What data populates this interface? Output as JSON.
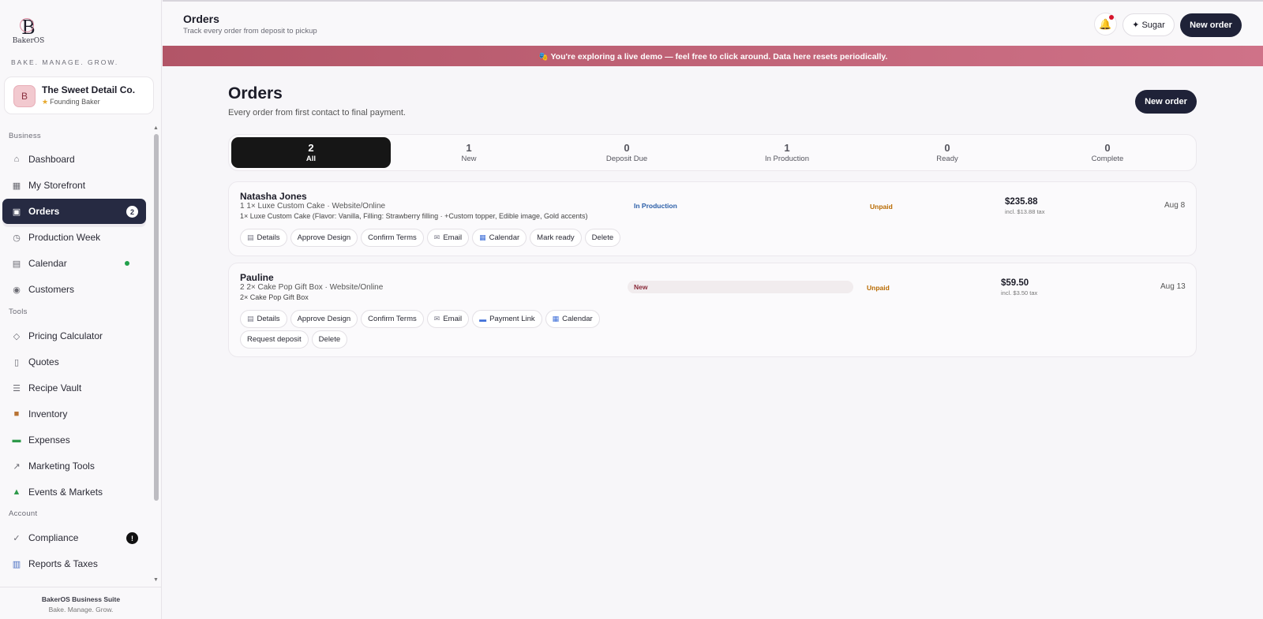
{
  "brand": {
    "mark": "B",
    "word": "BakerOS",
    "tagline": "BAKE. MANAGE. GROW."
  },
  "bakery": {
    "initial": "B",
    "name": "The Sweet Detail Co.",
    "badge": "Founding Baker"
  },
  "sidebar": {
    "sections": {
      "business": "Business",
      "tools": "Tools",
      "account": "Account"
    },
    "items": [
      {
        "label": "Dashboard",
        "icon": "home-icon"
      },
      {
        "label": "My Storefront",
        "icon": "picture-icon"
      },
      {
        "label": "Orders",
        "icon": "clipboard-icon",
        "badge": "2"
      },
      {
        "label": "Production Week",
        "icon": "clock-icon"
      },
      {
        "label": "Calendar",
        "icon": "calendar-icon"
      },
      {
        "label": "Customers",
        "icon": "user-icon"
      },
      {
        "label": "Pricing Calculator",
        "icon": "diamond-icon"
      },
      {
        "label": "Quotes",
        "icon": "document-icon"
      },
      {
        "label": "Recipe Vault",
        "icon": "list-icon"
      },
      {
        "label": "Inventory",
        "icon": "box-icon"
      },
      {
        "label": "Expenses",
        "icon": "money-icon"
      },
      {
        "label": "Marketing Tools",
        "icon": "trend-icon"
      },
      {
        "label": "Events & Markets",
        "icon": "tent-icon"
      },
      {
        "label": "Compliance",
        "icon": "check-icon",
        "alert": "!"
      },
      {
        "label": "Reports & Taxes",
        "icon": "bar-chart-icon"
      }
    ],
    "footer": {
      "title": "BakerOS Business Suite",
      "sub": "Bake. Manage. Grow."
    }
  },
  "topbar": {
    "title": "Orders",
    "subtitle": "Track every order from deposit to pickup",
    "sugar_label": "✦ Sugar",
    "new_order_label": "New order"
  },
  "banner": {
    "text": "🎭 You're exploring a live demo — feel free to click around. Data here resets periodically."
  },
  "main": {
    "title": "Orders",
    "subtitle": "Every order from first contact to final payment.",
    "new_order_label": "New order"
  },
  "tabs": [
    {
      "count": "2",
      "label": "All"
    },
    {
      "count": "1",
      "label": "New"
    },
    {
      "count": "0",
      "label": "Deposit Due"
    },
    {
      "count": "1",
      "label": "In Production"
    },
    {
      "count": "0",
      "label": "Ready"
    },
    {
      "count": "0",
      "label": "Complete"
    }
  ],
  "orders": [
    {
      "name": "Natasha Jones",
      "line1": "1 1× Luxe Custom Cake · Website/Online",
      "line2": "1× Luxe Custom Cake (Flavor: Vanilla, Filling: Strawberry filling · +Custom topper, Edible image, Gold accents)",
      "status": "In Production",
      "payment": "Unpaid",
      "amount": "$235.88",
      "tax": "incl. $13.88 tax",
      "date": "Aug 8",
      "actions": [
        "Details",
        "Approve Design",
        "Confirm Terms",
        "Email",
        "Calendar",
        "Mark ready",
        "Delete"
      ]
    },
    {
      "name": "Pauline",
      "line1": "2 2× Cake Pop Gift Box · Website/Online",
      "line2": "2× Cake Pop Gift Box",
      "status": "New",
      "payment": "Unpaid",
      "amount": "$59.50",
      "tax": "incl. $3.50 tax",
      "date": "Aug 13",
      "actions": [
        "Details",
        "Approve Design",
        "Confirm Terms",
        "Email",
        "Payment Link",
        "Calendar",
        "Request deposit",
        "Delete"
      ]
    }
  ]
}
